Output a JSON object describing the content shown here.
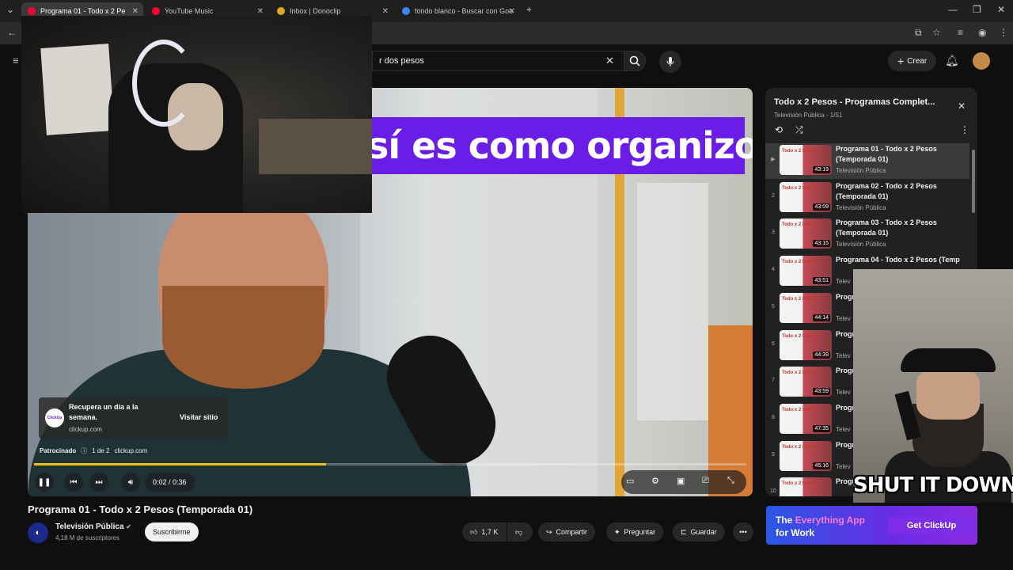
{
  "browser": {
    "tabs": [
      {
        "label": "Programa 01 - Todo x 2 Pe",
        "fav_color": "#ff0033",
        "active": true
      },
      {
        "label": "YouTube Music",
        "fav_color": "#ff0033",
        "active": false
      },
      {
        "label": "Inbox | Donoclip",
        "fav_color": "#e5a323",
        "active": false
      },
      {
        "label": "fondo blanco - Buscar con Goo",
        "fav_color": "#4285f4",
        "active": false
      }
    ]
  },
  "header": {
    "search_value": "r dos pesos",
    "create_label": "Crear"
  },
  "video": {
    "banner_text": "sí es como organizo",
    "ad": {
      "title": "Recupera un día a la semana.",
      "domain": "clickup.com",
      "visit_label": "Visitar sitio",
      "sponsored": "Patrocinado",
      "count": "1 de 2",
      "sponsor_domain": "clickup.com",
      "logo_text": "ClickUp"
    },
    "progress_fraction": 0.41,
    "time": "0:02 / 0:36"
  },
  "overlay": {
    "meme_caption": "SHUT IT DOWN"
  },
  "below": {
    "title": "Programa 01 - Todo x 2 Pesos (Temporada 01)",
    "channel": "Televisión Pública",
    "subscribers": "4,18 M de suscriptores",
    "subscribe_label": "Suscribirme",
    "likes": "1,7 K",
    "share_label": "Compartir",
    "ask_label": "Preguntar",
    "save_label": "Guardar"
  },
  "playlist": {
    "title": "Todo x 2 Pesos - Programas Complet...",
    "subtitle": "Televisión Pública - 1/51",
    "items": [
      {
        "index": "▶",
        "name": "Programa 01 - Todo x 2 Pesos (Temporada 01)",
        "channel": "Televisión Pública",
        "duration": "43:19"
      },
      {
        "index": "2",
        "name": "Programa 02 - Todo x 2 Pesos (Temporada 01)",
        "channel": "Televisión Pública",
        "duration": "43:09"
      },
      {
        "index": "3",
        "name": "Programa 03 - Todo x 2 Pesos (Temporada 01)",
        "channel": "Televisión Pública",
        "duration": "43:15"
      },
      {
        "index": "4",
        "name": "Programa 04 - Todo x 2 Pesos (Temp",
        "channel": "Telev",
        "duration": "43:51"
      },
      {
        "index": "5",
        "name": "Progra (Tem",
        "channel": "Telev",
        "duration": "44:14"
      },
      {
        "index": "6",
        "name": "Progra (Tem",
        "channel": "Telev",
        "duration": "44:39"
      },
      {
        "index": "7",
        "name": "Progra (Tem",
        "channel": "Telev",
        "duration": "43:59"
      },
      {
        "index": "8",
        "name": "Progra (Tem",
        "channel": "Telev",
        "duration": "47:35"
      },
      {
        "index": "9",
        "name": "Progra (Tem",
        "channel": "Telev",
        "duration": "45:16"
      },
      {
        "index": "10",
        "name": "Progra (Tem",
        "channel": "",
        "duration": ""
      }
    ],
    "thumb_label": "Todo x 2 Pesos"
  },
  "sidebar_ad": {
    "line1_a": "The ",
    "line1_b": "Everything App",
    "line2": "for Work",
    "button": "Get ClickUp"
  }
}
